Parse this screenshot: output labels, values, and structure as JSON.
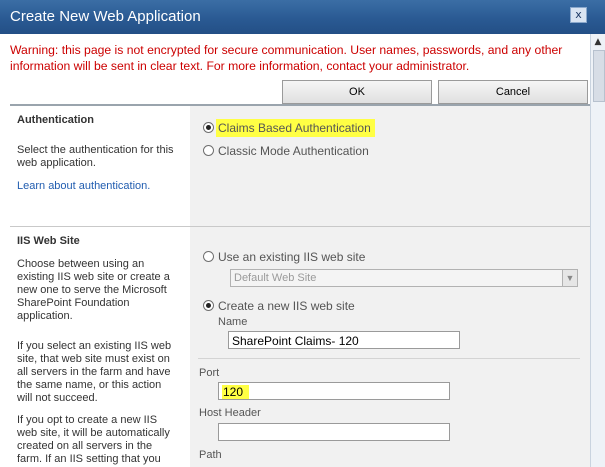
{
  "window": {
    "title": "Create New Web Application",
    "close_label": "x"
  },
  "warning": "Warning: this page is not encrypted for secure communication. User names, passwords, and any other information will be sent in clear text. For more information, contact your administrator.",
  "buttons": {
    "ok": "OK",
    "cancel": "Cancel"
  },
  "authentication": {
    "title": "Authentication",
    "description": "Select the authentication for this web application.",
    "link": "Learn about authentication.",
    "options": [
      {
        "label": "Claims Based Authentication",
        "selected": true
      },
      {
        "label": "Classic Mode Authentication",
        "selected": false
      }
    ]
  },
  "iis": {
    "title": "IIS Web Site",
    "description_1": "Choose between using an existing IIS web site or create a new one to serve the Microsoft SharePoint Foundation application.",
    "description_2": "If you select an existing IIS web site, that web site must exist on all servers in the farm and have the same name, or this action will not succeed.",
    "description_3": "If you opt to create a new IIS web site, it will be automatically created on all servers in the farm.  If an IIS setting that you",
    "use_existing_label": "Use an existing IIS web site",
    "existing_site_value": "Default Web Site",
    "create_new_label": "Create a new IIS web site",
    "name_label": "Name",
    "name_value": "SharePoint Claims- 120",
    "port_label": "Port",
    "port_value": "120",
    "host_header_label": "Host Header",
    "host_header_value": "",
    "path_label": "Path"
  },
  "colors": {
    "title_bar": "#2a5a93",
    "warning_text": "#cc0000",
    "highlight": "#ffff44",
    "link": "#215db0"
  }
}
